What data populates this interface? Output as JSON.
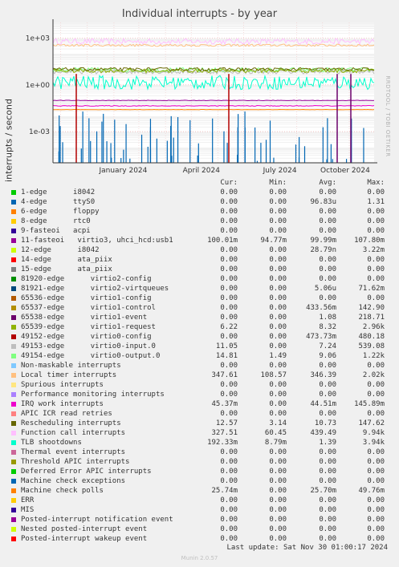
{
  "chart_data": {
    "type": "line",
    "title": "Individual interrupts - by year",
    "ylabel": "interrupts / second",
    "yscale": "log",
    "y_ticks": [
      "1e+03",
      "1e+00",
      "1e-03"
    ],
    "y_tick_values": [
      1000,
      1,
      0.001
    ],
    "ylim": [
      1e-05,
      10000
    ],
    "x_ticks": [
      "January 2024",
      "April 2024",
      "July 2024",
      "October 2024"
    ],
    "xlim": [
      "2023-11-22",
      "2024-11-30"
    ],
    "grid": true,
    "legend_position": "bottom",
    "columns": [
      "Cur:",
      "Min:",
      "Avg:",
      "Max:"
    ],
    "series": [
      {
        "name": "1-edge      i8042",
        "color": "#00cc00",
        "cur": "0.00",
        "min": "0.00",
        "avg": "0.00",
        "max": "0.00"
      },
      {
        "name": "4-edge      ttyS0",
        "color": "#0066b3",
        "cur": "0.00",
        "min": "0.00",
        "avg": "96.83u",
        "max": "1.31"
      },
      {
        "name": "6-edge      floppy",
        "color": "#ff8000",
        "cur": "0.00",
        "min": "0.00",
        "avg": "0.00",
        "max": "0.00"
      },
      {
        "name": "8-edge      rtc0",
        "color": "#ffcc00",
        "cur": "0.00",
        "min": "0.00",
        "avg": "0.00",
        "max": "0.00"
      },
      {
        "name": "9-fasteoi   acpi",
        "color": "#330099",
        "cur": "0.00",
        "min": "0.00",
        "avg": "0.00",
        "max": "0.00"
      },
      {
        "name": "11-fasteoi   virtio3, uhci_hcd:usb1",
        "color": "#990099",
        "cur": "100.01m",
        "min": "94.77m",
        "avg": "99.99m",
        "max": "107.80m"
      },
      {
        "name": "12-edge      i8042",
        "color": "#ccff00",
        "cur": "0.00",
        "min": "0.00",
        "avg": "28.79n",
        "max": "3.22m"
      },
      {
        "name": "14-edge      ata_piix",
        "color": "#ff0000",
        "cur": "0.00",
        "min": "0.00",
        "avg": "0.00",
        "max": "0.00"
      },
      {
        "name": "15-edge      ata_piix",
        "color": "#808080",
        "cur": "0.00",
        "min": "0.00",
        "avg": "0.00",
        "max": "0.00"
      },
      {
        "name": "81920-edge      virtio2-config",
        "color": "#008f00",
        "cur": "0.00",
        "min": "0.00",
        "avg": "0.00",
        "max": "0.00"
      },
      {
        "name": "81921-edge      virtio2-virtqueues",
        "color": "#00487d",
        "cur": "0.00",
        "min": "0.00",
        "avg": "5.06u",
        "max": "71.62m"
      },
      {
        "name": "65536-edge      virtio1-config",
        "color": "#b35a00",
        "cur": "0.00",
        "min": "0.00",
        "avg": "0.00",
        "max": "0.00"
      },
      {
        "name": "65537-edge      virtio1-control",
        "color": "#b38f00",
        "cur": "0.00",
        "min": "0.00",
        "avg": "433.56m",
        "max": "142.90"
      },
      {
        "name": "65538-edge      virtio1-event",
        "color": "#6b006b",
        "cur": "0.00",
        "min": "0.00",
        "avg": "1.08",
        "max": "218.71"
      },
      {
        "name": "65539-edge      virtio1-request",
        "color": "#8fb300",
        "cur": "6.22",
        "min": "0.00",
        "avg": "8.32",
        "max": "2.96k"
      },
      {
        "name": "49152-edge      virtio0-config",
        "color": "#b30000",
        "cur": "0.00",
        "min": "0.00",
        "avg": "473.73m",
        "max": "480.18"
      },
      {
        "name": "49153-edge      virtio0-input.0",
        "color": "#bebebe",
        "cur": "11.05",
        "min": "0.00",
        "avg": "7.24",
        "max": "539.08"
      },
      {
        "name": "49154-edge      virtio0-output.0",
        "color": "#80ff80",
        "cur": "14.81",
        "min": "1.49",
        "avg": "9.06",
        "max": "1.22k"
      },
      {
        "name": "Non-maskable interrupts",
        "color": "#80c9ff",
        "cur": "0.00",
        "min": "0.00",
        "avg": "0.00",
        "max": "0.00"
      },
      {
        "name": "Local timer interrupts",
        "color": "#ffc080",
        "cur": "347.61",
        "min": "108.57",
        "avg": "346.39",
        "max": "2.02k"
      },
      {
        "name": "Spurious interrupts",
        "color": "#ffe680",
        "cur": "0.00",
        "min": "0.00",
        "avg": "0.00",
        "max": "0.00"
      },
      {
        "name": "Performance monitoring interrupts",
        "color": "#aa80ff",
        "cur": "0.00",
        "min": "0.00",
        "avg": "0.00",
        "max": "0.00"
      },
      {
        "name": "IRQ work interrupts",
        "color": "#ee00cc",
        "cur": "45.37m",
        "min": "0.00",
        "avg": "44.51m",
        "max": "145.89m"
      },
      {
        "name": "APIC ICR read retries",
        "color": "#ff8080",
        "cur": "0.00",
        "min": "0.00",
        "avg": "0.00",
        "max": "0.00"
      },
      {
        "name": "Rescheduling interrupts",
        "color": "#666600",
        "cur": "12.57",
        "min": "3.14",
        "avg": "10.73",
        "max": "147.62"
      },
      {
        "name": "Function call interrupts",
        "color": "#ffbfff",
        "cur": "327.51",
        "min": "60.45",
        "avg": "439.49",
        "max": "9.94k"
      },
      {
        "name": "TLB shootdowns",
        "color": "#00ffcc",
        "cur": "192.33m",
        "min": "8.79m",
        "avg": "1.39",
        "max": "3.94k"
      },
      {
        "name": "Thermal event interrupts",
        "color": "#cc6699",
        "cur": "0.00",
        "min": "0.00",
        "avg": "0.00",
        "max": "0.00"
      },
      {
        "name": "Threshold APIC interrupts",
        "color": "#999900",
        "cur": "0.00",
        "min": "0.00",
        "avg": "0.00",
        "max": "0.00"
      },
      {
        "name": "Deferred Error APIC interrupts",
        "color": "#00cc00",
        "cur": "0.00",
        "min": "0.00",
        "avg": "0.00",
        "max": "0.00"
      },
      {
        "name": "Machine check exceptions",
        "color": "#0066b3",
        "cur": "0.00",
        "min": "0.00",
        "avg": "0.00",
        "max": "0.00"
      },
      {
        "name": "Machine check polls",
        "color": "#ff8000",
        "cur": "25.74m",
        "min": "0.00",
        "avg": "25.70m",
        "max": "49.76m"
      },
      {
        "name": "ERR",
        "color": "#ffcc00",
        "cur": "0.00",
        "min": "0.00",
        "avg": "0.00",
        "max": "0.00"
      },
      {
        "name": "MIS",
        "color": "#330099",
        "cur": "0.00",
        "min": "0.00",
        "avg": "0.00",
        "max": "0.00"
      },
      {
        "name": "Posted-interrupt notification event",
        "color": "#990099",
        "cur": "0.00",
        "min": "0.00",
        "avg": "0.00",
        "max": "0.00"
      },
      {
        "name": "Nested posted-interrupt event",
        "color": "#ccff00",
        "cur": "0.00",
        "min": "0.00",
        "avg": "0.00",
        "max": "0.00"
      },
      {
        "name": "Posted-interrupt wakeup event",
        "color": "#ff0000",
        "cur": "0.00",
        "min": "0.00",
        "avg": "0.00",
        "max": "0.00"
      }
    ],
    "line_levels": [
      {
        "name": "Function call interrupts",
        "color": "#ffbfff",
        "typical": 600,
        "noise": 0.35
      },
      {
        "name": "Local timer interrupts",
        "color": "#ffc080",
        "typical": 346,
        "noise": 0.15
      },
      {
        "name": "49154-edge      virtio0-output.0",
        "color": "#80ff80",
        "typical": 9,
        "noise": 0.3
      },
      {
        "name": "49153-edge      virtio0-input.0",
        "color": "#bebebe",
        "typical": 7,
        "noise": 0.3
      },
      {
        "name": "65539-edge      virtio1-request",
        "color": "#8fb300",
        "typical": 8,
        "noise": 0.25
      },
      {
        "name": "Rescheduling interrupts",
        "color": "#666600",
        "typical": 10,
        "noise": 0.2
      },
      {
        "name": "TLB shootdowns",
        "color": "#00ffcc",
        "typical": 1.4,
        "noise": 0.9
      },
      {
        "name": "11-fasteoi   virtio3, uhci_hcd:usb1",
        "color": "#990099",
        "typical": 0.1,
        "noise": 0.03
      },
      {
        "name": "IRQ work interrupts",
        "color": "#ee00cc",
        "typical": 0.045,
        "noise": 0.05
      },
      {
        "name": "Machine check polls",
        "color": "#ff8000",
        "typical": 0.0257,
        "noise": 0.02
      }
    ]
  },
  "watermark": "RRDTOOL / TOBI OETIKER",
  "last_update": "Last update: Sat Nov 30 01:00:17 2024",
  "footer": "Munin 2.0.57"
}
